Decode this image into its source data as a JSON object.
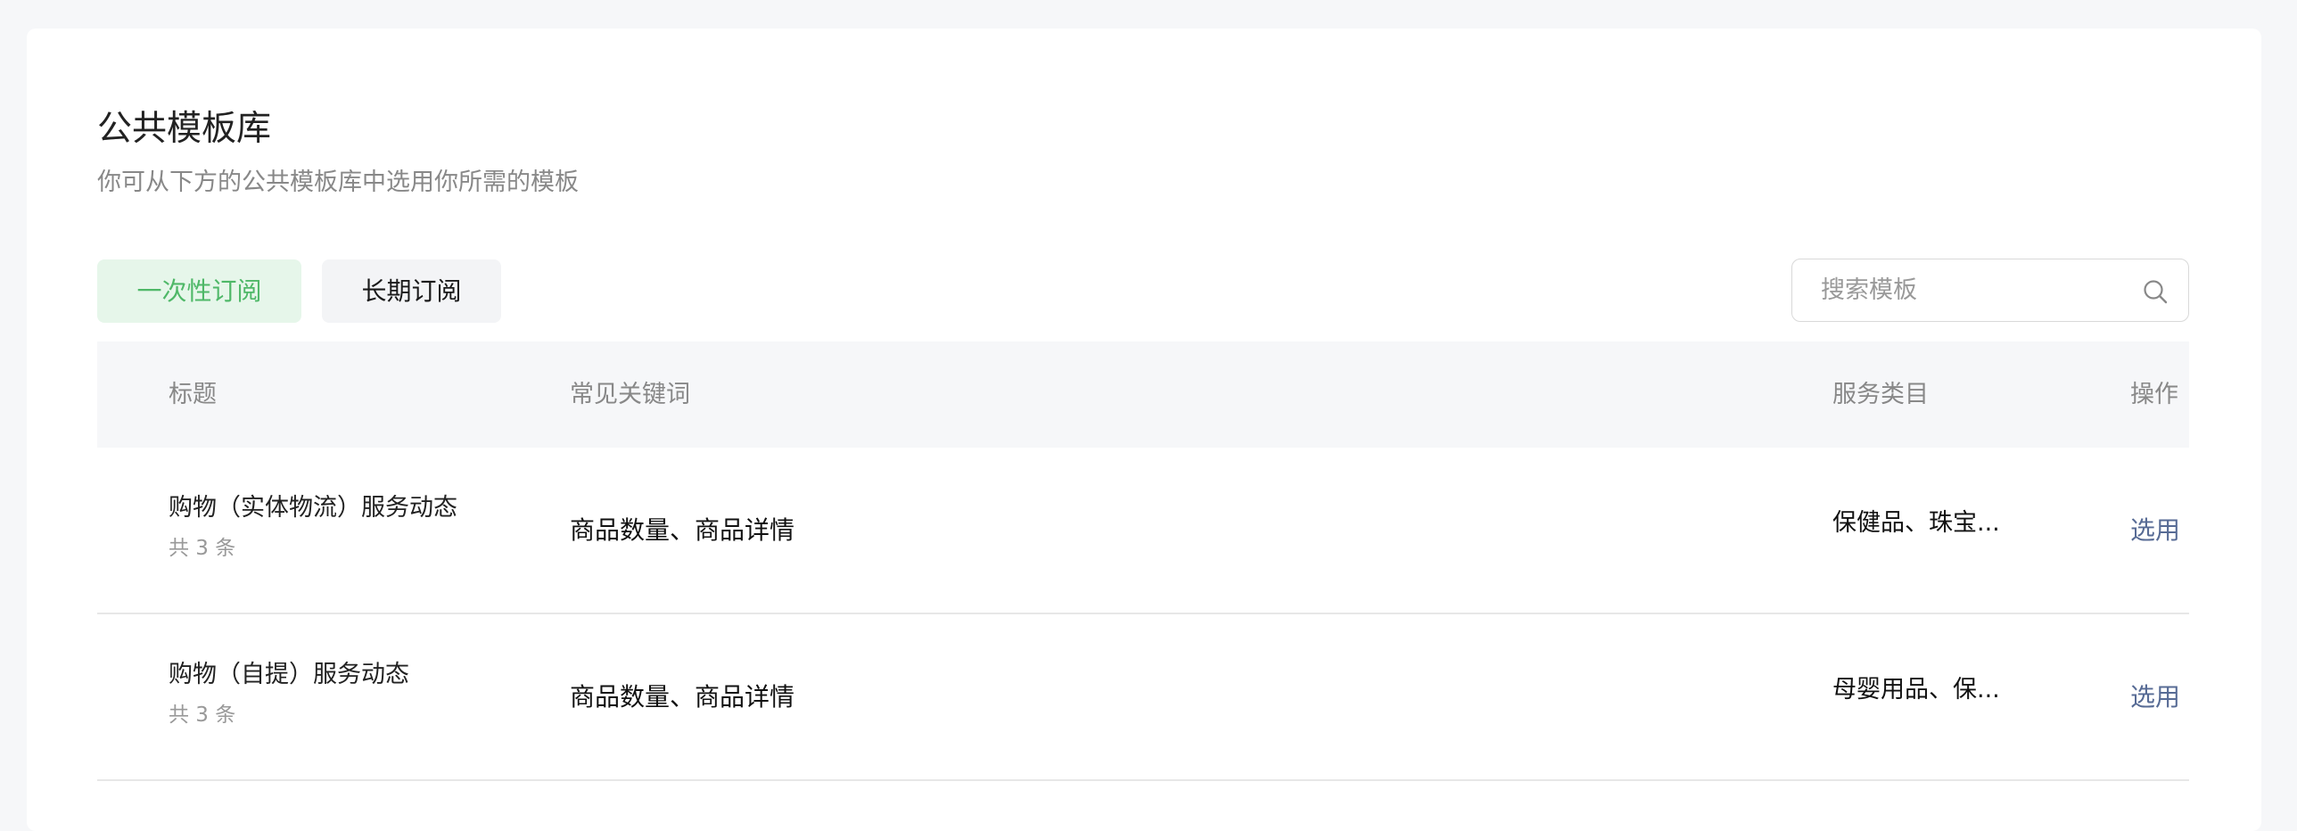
{
  "header": {
    "title": "公共模板库",
    "subtitle": "你可从下方的公共模板库中选用你所需的模板"
  },
  "tabs": [
    {
      "label": "一次性订阅",
      "active": true
    },
    {
      "label": "长期订阅",
      "active": false
    }
  ],
  "search": {
    "placeholder": "搜索模板",
    "icon": "search-icon"
  },
  "table": {
    "columns": [
      "标题",
      "常见关键词",
      "服务类目",
      "操作"
    ],
    "rows": [
      {
        "title": "购物（实体物流）服务动态",
        "count": "共 3 条",
        "keywords": "商品数量、商品详情",
        "category": "保健品、珠宝...",
        "action": "选用"
      },
      {
        "title": "购物（自提）服务动态",
        "count": "共 3 条",
        "keywords": "商品数量、商品详情",
        "category": "母婴用品、保...",
        "action": "选用"
      }
    ]
  },
  "colors": {
    "accent_green": "#4fb868",
    "tab_active_bg": "#e6f6ea",
    "link_blue": "#576b95"
  }
}
